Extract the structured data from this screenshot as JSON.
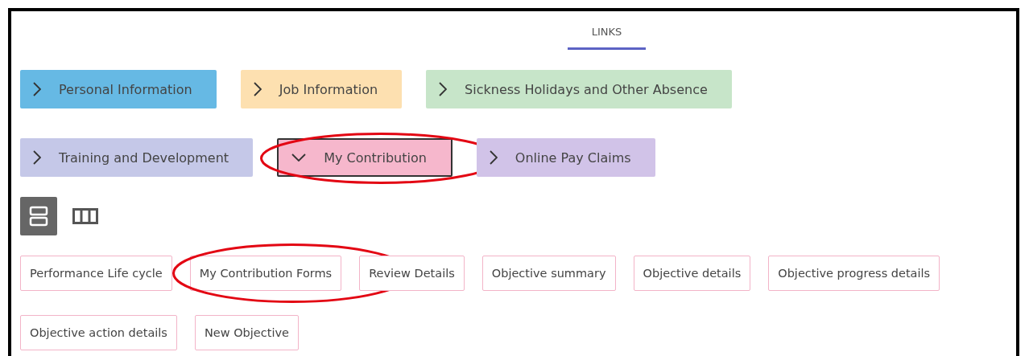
{
  "tabs": [
    {
      "label": "LINKS",
      "selected": true
    }
  ],
  "sections": [
    {
      "label": "Personal Information",
      "color": "#66b9e4",
      "expanded": false,
      "circled": false
    },
    {
      "label": "Job Information",
      "color": "#fde0b0",
      "expanded": false,
      "circled": false
    },
    {
      "label": "Sickness Holidays and Other Absence",
      "color": "#c7e5c9",
      "expanded": false,
      "circled": false
    },
    {
      "label": "Training and Development",
      "color": "#c5c8e8",
      "expanded": false,
      "circled": false
    },
    {
      "label": "My Contribution",
      "color": "#f6b7cc",
      "expanded": true,
      "circled": true
    },
    {
      "label": "Online Pay Claims",
      "color": "#d1c3e8",
      "expanded": false,
      "circled": false
    }
  ],
  "view_toggle": [
    {
      "kind": "rows",
      "selected": true
    },
    {
      "kind": "columns",
      "selected": false
    }
  ],
  "links": [
    {
      "label": "Performance Life cycle",
      "circled": false
    },
    {
      "label": "My Contribution Forms",
      "circled": true
    },
    {
      "label": "Review Details",
      "circled": false
    },
    {
      "label": "Objective summary",
      "circled": false
    },
    {
      "label": "Objective details",
      "circled": false
    },
    {
      "label": "Objective progress details",
      "circled": false
    },
    {
      "label": "Objective action details",
      "circled": false
    },
    {
      "label": "New Objective",
      "circled": false
    }
  ]
}
